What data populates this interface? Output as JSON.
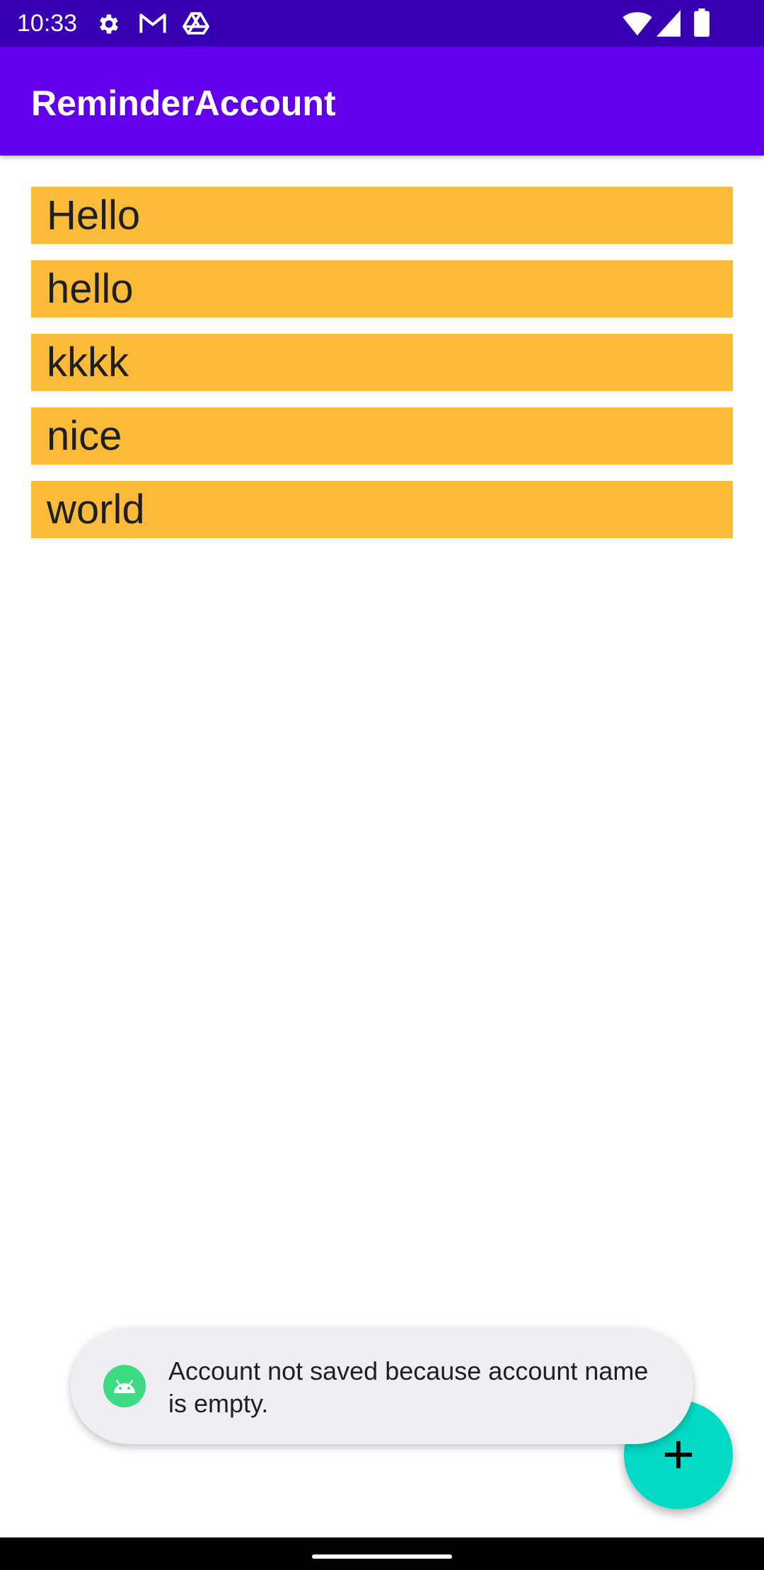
{
  "status_bar": {
    "time": "10:33",
    "icons": [
      "gear-icon",
      "gmail-icon",
      "drive-icon",
      "wifi-icon",
      "signal-icon",
      "battery-icon"
    ]
  },
  "app_bar": {
    "title": "ReminderAccount"
  },
  "accounts": [
    {
      "name": "Hello"
    },
    {
      "name": "hello"
    },
    {
      "name": "kkkk"
    },
    {
      "name": "nice"
    },
    {
      "name": "world"
    }
  ],
  "fab": {
    "icon": "plus-icon"
  },
  "toast": {
    "message": "Account not saved because account name is empty.",
    "icon": "android-icon"
  },
  "colors": {
    "status_bar": "#3700b3",
    "app_bar": "#6200ee",
    "list_item": "#fbba37",
    "fab": "#03dac5",
    "toast": "#efeef2"
  }
}
